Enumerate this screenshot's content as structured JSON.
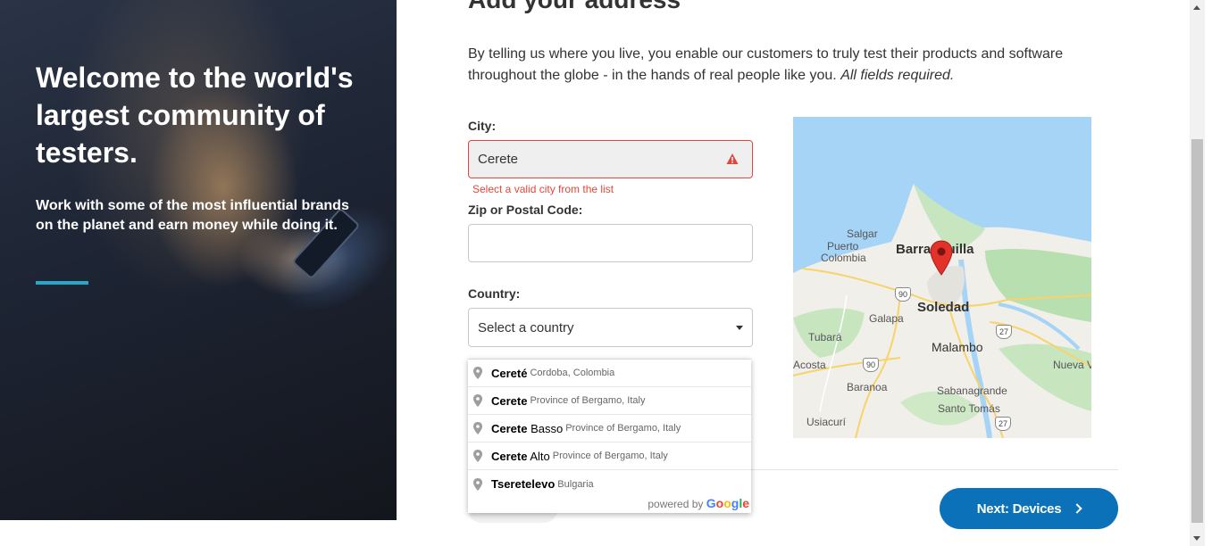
{
  "hero": {
    "title": "Welcome to the world's largest community of testers.",
    "subtitle": "Work with some of the most influential brands on the planet and earn money while doing it."
  },
  "form": {
    "page_title": "Add your address",
    "intro": "By telling us where you live, you enable our customers to truly test their products and software throughout the globe - in the hands of real people like you.",
    "intro_required": "All fields required.",
    "city_label": "City:",
    "city_value": "Cerete",
    "city_error": "Select a valid city from the list",
    "zip_label": "Zip or Postal Code:",
    "zip_value": "",
    "country_label": "Country:",
    "country_value": "Select a country"
  },
  "autocomplete": {
    "items": [
      {
        "main_bold": "Cereté",
        "main_rest": "",
        "secondary": "Cordoba, Colombia"
      },
      {
        "main_bold": "Cerete",
        "main_rest": "",
        "secondary": "Province of Bergamo, Italy"
      },
      {
        "main_bold": "Cerete",
        "main_rest": " Basso",
        "secondary": "Province of Bergamo, Italy"
      },
      {
        "main_bold": "Cerete",
        "main_rest": " Alto",
        "secondary": "Province of Bergamo, Italy"
      },
      {
        "main_bold": "Tseretelevo",
        "main_rest": "",
        "secondary": "Bulgaria"
      }
    ],
    "powered_by": "powered by",
    "brand": "Google"
  },
  "map": {
    "places": {
      "salgar": "Salgar",
      "puerto": "Puerto",
      "colombia": "Colombia",
      "barranquilla": "Barranquilla",
      "soledad": "Soledad",
      "galapa": "Galapa",
      "tubara": "Tubará",
      "malambo": "Malambo",
      "acosta": "Acosta",
      "baranoa": "Baranoa",
      "sabanagrande": "Sabanagrande",
      "santo_tomas": "Santo Tomás",
      "usiacuri": "Usiacurí",
      "nueva": "Nueva V"
    },
    "shields": {
      "r90a": "90",
      "r90b": "90",
      "r27a": "27",
      "r27b": "27"
    }
  },
  "footer": {
    "next_label": "Next: Devices"
  },
  "colors": {
    "accent": "#0b72b9",
    "error": "#e0483c",
    "hero_bar": "#2ba6cb"
  }
}
